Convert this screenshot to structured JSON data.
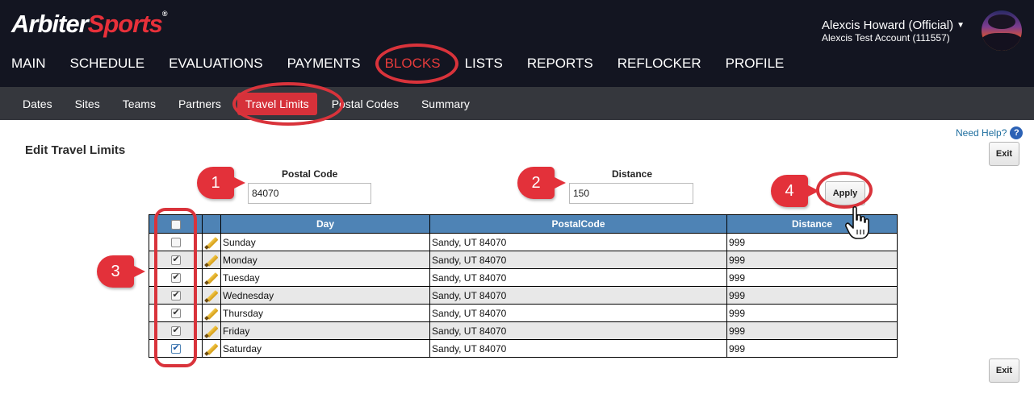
{
  "brand": {
    "logo_arbiter": "Arbiter",
    "logo_sports": "Sports",
    "tm": "®"
  },
  "user": {
    "name": "Alexcis Howard (Official)",
    "account": "Alexcis Test Account (111557)"
  },
  "main_nav": [
    "MAIN",
    "SCHEDULE",
    "EVALUATIONS",
    "PAYMENTS",
    "BLOCKS",
    "LISTS",
    "REPORTS",
    "REFLOCKER",
    "PROFILE"
  ],
  "sub_nav": [
    "Dates",
    "Sites",
    "Teams",
    "Partners",
    "Travel Limits",
    "Postal Codes",
    "Summary"
  ],
  "help": {
    "label": "Need Help?",
    "icon": "?"
  },
  "page": {
    "title": "Edit Travel Limits",
    "exit_label": "Exit",
    "apply_label": "Apply"
  },
  "form": {
    "postal_code_label": "Postal Code",
    "postal_code_value": "84070",
    "distance_label": "Distance",
    "distance_value": "150"
  },
  "markers": [
    "1",
    "2",
    "3",
    "4"
  ],
  "table": {
    "headers": [
      "Day",
      "PostalCode",
      "Distance"
    ],
    "rows": [
      {
        "day": "Sunday",
        "postal": "Sandy, UT 84070",
        "distance": "999",
        "checked": false
      },
      {
        "day": "Monday",
        "postal": "Sandy, UT 84070",
        "distance": "999",
        "checked": true
      },
      {
        "day": "Tuesday",
        "postal": "Sandy, UT 84070",
        "distance": "999",
        "checked": true
      },
      {
        "day": "Wednesday",
        "postal": "Sandy, UT 84070",
        "distance": "999",
        "checked": true
      },
      {
        "day": "Thursday",
        "postal": "Sandy, UT 84070",
        "distance": "999",
        "checked": true
      },
      {
        "day": "Friday",
        "postal": "Sandy, UT 84070",
        "distance": "999",
        "checked": true
      },
      {
        "day": "Saturday",
        "postal": "Sandy, UT 84070",
        "distance": "999",
        "checked": true
      }
    ]
  },
  "colors": {
    "topbar": "#131521",
    "subnav": "#35373d",
    "accent_red": "#d9333b",
    "table_header": "#4e83b5"
  }
}
